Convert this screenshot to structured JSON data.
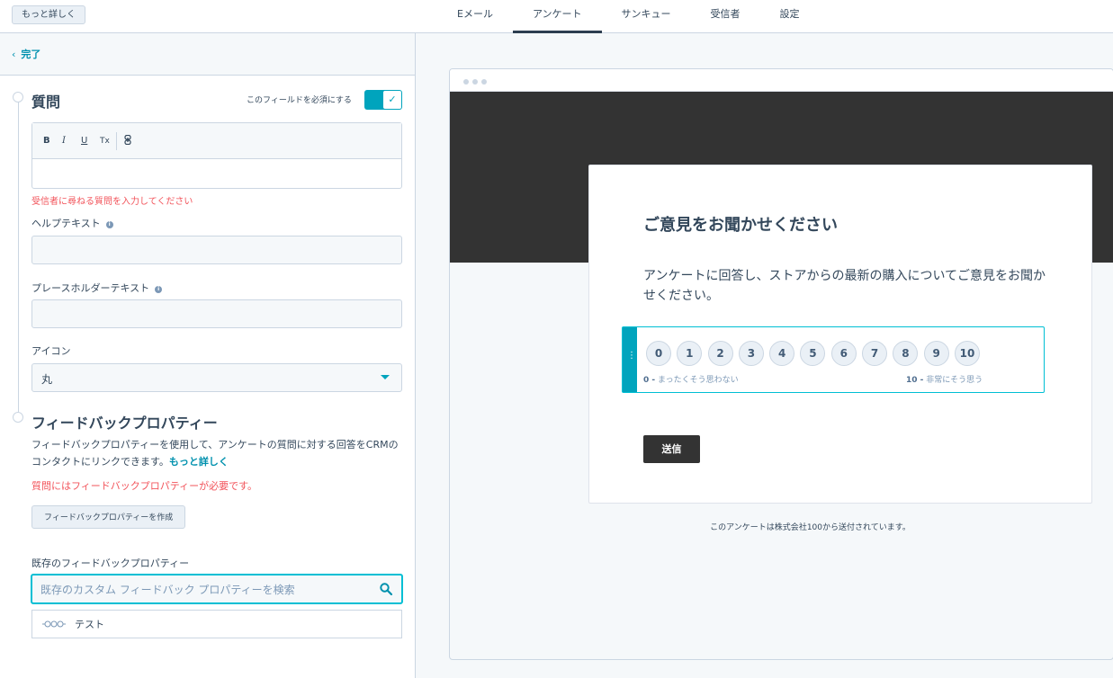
{
  "topbar": {
    "more_button": "もっと詳しく",
    "tabs": [
      "Eメール",
      "アンケート",
      "サンキュー",
      "受信者",
      "設定"
    ],
    "active_tab": "アンケート"
  },
  "left": {
    "done_label": "完了",
    "question_section": {
      "title": "質問",
      "required_label": "このフィールドを必須にする",
      "required_on": true,
      "toolbar": [
        "B",
        "I",
        "U",
        "Tx",
        "link"
      ],
      "error": "受信者に尋ねる質問を入力してください",
      "help_text_label": "ヘルプテキスト",
      "help_text_value": "",
      "placeholder_label": "プレースホルダーテキスト",
      "placeholder_value": "",
      "icon_label": "アイコン",
      "icon_value": "丸"
    },
    "feedback_section": {
      "title": "フィードバックプロパティー",
      "description": "フィードバックプロパティーを使用して、アンケートの質問に対する回答をCRMのコンタクトにリンクできます。",
      "learn_more": "もっと詳しく",
      "error": "質問にはフィードバックプロパティーが必要です。",
      "create_button": "フィードバックプロパティーを作成",
      "existing_label": "既存のフィードバックプロパティー",
      "search_placeholder": "既存のカスタム フィードバック プロパティーを検索",
      "results": [
        "テスト"
      ]
    }
  },
  "preview": {
    "title": "ご意見をお聞かせください",
    "body": "アンケートに回答し、ストアからの最新の購入についてご意見をお聞かせください。",
    "scale": [
      "0",
      "1",
      "2",
      "3",
      "4",
      "5",
      "6",
      "7",
      "8",
      "9",
      "10"
    ],
    "low_num": "0 -",
    "low_label": "まったくそう思わない",
    "high_num": "10 -",
    "high_label": "非常にそう思う",
    "submit": "送信",
    "footer": "このアンケートは株式会社100から送付されています。"
  }
}
